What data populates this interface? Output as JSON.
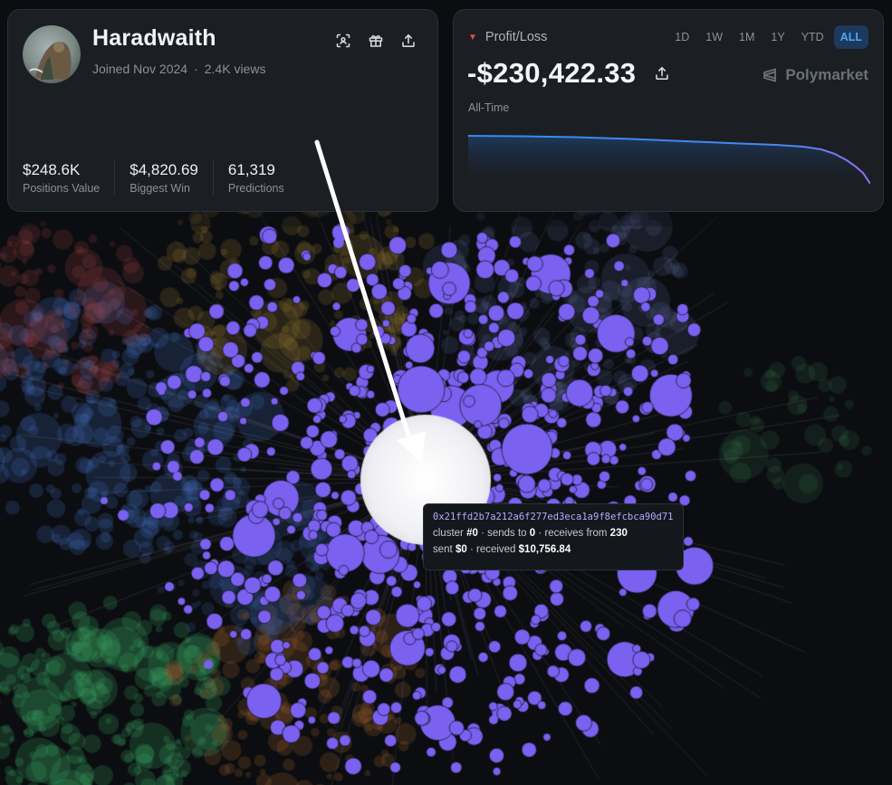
{
  "profile": {
    "username": "Haradwaith",
    "joined": "Joined Nov 2024",
    "views": "2.4K views",
    "icons": [
      "scan-icon",
      "gift-icon",
      "share-icon"
    ],
    "stats": [
      {
        "value": "$248.6K",
        "label": "Positions Value"
      },
      {
        "value": "$4,820.69",
        "label": "Biggest Win"
      },
      {
        "value": "61,319",
        "label": "Predictions"
      }
    ]
  },
  "pnl": {
    "label": "Profit/Loss",
    "value": "-$230,422.33",
    "brand": "Polymarket",
    "period": "All-Time",
    "ranges": [
      "1D",
      "1W",
      "1M",
      "1Y",
      "YTD",
      "ALL"
    ],
    "active_range": "ALL"
  },
  "tooltip": {
    "address": "0x21ffd2b7a212a6f277ed3eca1a9f8efcbca90d71",
    "cluster_label": "cluster",
    "cluster": "#0",
    "sends_label": "sends to",
    "sends_to": "0",
    "receives_label": "receives from",
    "receives_from": "230",
    "sent_label": "sent",
    "sent": "$0",
    "received_label": "received",
    "received": "$10,756.84"
  },
  "colors": {
    "accent_purple": "#7b61f0",
    "accent_blue": "#4ea5f7",
    "loss_red": "#e5484d",
    "card_bg": "#1b1e23",
    "page_bg": "#0b0d10"
  }
}
